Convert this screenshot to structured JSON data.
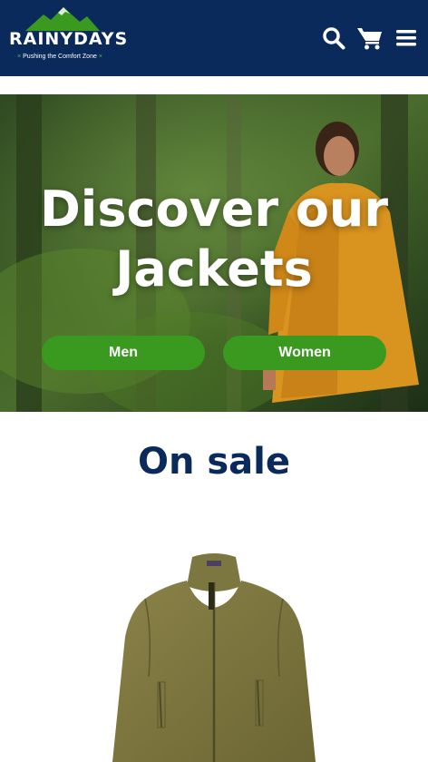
{
  "header": {
    "logo": {
      "word": "RAINYDAYS",
      "tagline": "Pushing the Comfort Zone",
      "tagline_mark": "×"
    },
    "icons": [
      "search-icon",
      "cart-icon",
      "menu-icon"
    ],
    "colors": {
      "background": "#0b2a5c",
      "accent": "#57b846"
    }
  },
  "hero": {
    "title_line1": "Discover our",
    "title_line2": "Jackets",
    "buttons": {
      "men": "Men",
      "women": "Women"
    },
    "colors": {
      "button": "#3a9a1f"
    }
  },
  "sale": {
    "title": "On sale",
    "product_image": "olive-green-fleece-jacket"
  }
}
